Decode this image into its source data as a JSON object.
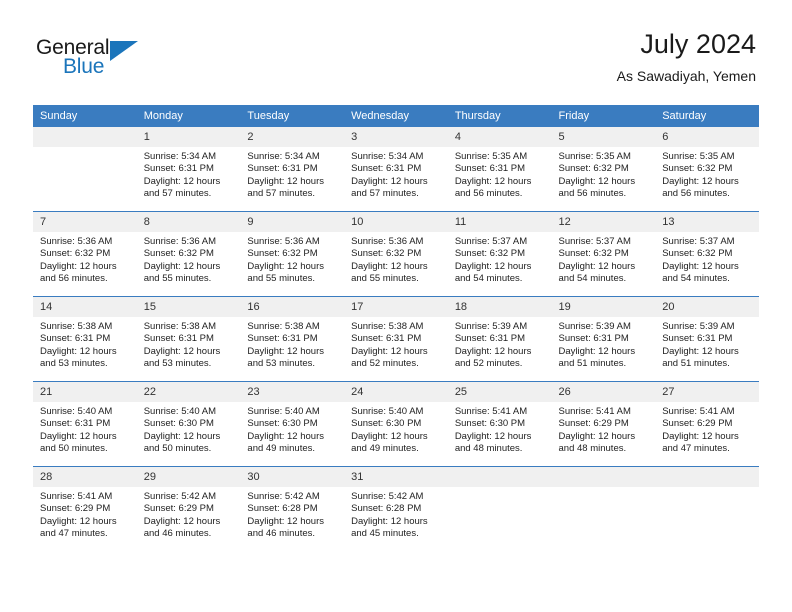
{
  "brand": {
    "name_top": "General",
    "name_bottom": "Blue",
    "accent_color": "#1b75bb"
  },
  "header": {
    "title": "July 2024",
    "location": "As Sawadiyah, Yemen"
  },
  "theme": {
    "header_row_color": "#3a7cc0",
    "daynum_strip_color": "#f0f0f0",
    "grid_line_color": "#3a7cc0",
    "text_color": "#222222"
  },
  "calendar": {
    "weekday_headers": [
      "Sunday",
      "Monday",
      "Tuesday",
      "Wednesday",
      "Thursday",
      "Friday",
      "Saturday"
    ],
    "weeks": [
      [
        {
          "day": "",
          "empty": true,
          "sunrise": "",
          "sunset": "",
          "daylight_line1": "",
          "daylight_line2": ""
        },
        {
          "day": "1",
          "empty": false,
          "sunrise": "Sunrise: 5:34 AM",
          "sunset": "Sunset: 6:31 PM",
          "daylight_line1": "Daylight: 12 hours",
          "daylight_line2": "and 57 minutes."
        },
        {
          "day": "2",
          "empty": false,
          "sunrise": "Sunrise: 5:34 AM",
          "sunset": "Sunset: 6:31 PM",
          "daylight_line1": "Daylight: 12 hours",
          "daylight_line2": "and 57 minutes."
        },
        {
          "day": "3",
          "empty": false,
          "sunrise": "Sunrise: 5:34 AM",
          "sunset": "Sunset: 6:31 PM",
          "daylight_line1": "Daylight: 12 hours",
          "daylight_line2": "and 57 minutes."
        },
        {
          "day": "4",
          "empty": false,
          "sunrise": "Sunrise: 5:35 AM",
          "sunset": "Sunset: 6:31 PM",
          "daylight_line1": "Daylight: 12 hours",
          "daylight_line2": "and 56 minutes."
        },
        {
          "day": "5",
          "empty": false,
          "sunrise": "Sunrise: 5:35 AM",
          "sunset": "Sunset: 6:32 PM",
          "daylight_line1": "Daylight: 12 hours",
          "daylight_line2": "and 56 minutes."
        },
        {
          "day": "6",
          "empty": false,
          "sunrise": "Sunrise: 5:35 AM",
          "sunset": "Sunset: 6:32 PM",
          "daylight_line1": "Daylight: 12 hours",
          "daylight_line2": "and 56 minutes."
        }
      ],
      [
        {
          "day": "7",
          "empty": false,
          "sunrise": "Sunrise: 5:36 AM",
          "sunset": "Sunset: 6:32 PM",
          "daylight_line1": "Daylight: 12 hours",
          "daylight_line2": "and 56 minutes."
        },
        {
          "day": "8",
          "empty": false,
          "sunrise": "Sunrise: 5:36 AM",
          "sunset": "Sunset: 6:32 PM",
          "daylight_line1": "Daylight: 12 hours",
          "daylight_line2": "and 55 minutes."
        },
        {
          "day": "9",
          "empty": false,
          "sunrise": "Sunrise: 5:36 AM",
          "sunset": "Sunset: 6:32 PM",
          "daylight_line1": "Daylight: 12 hours",
          "daylight_line2": "and 55 minutes."
        },
        {
          "day": "10",
          "empty": false,
          "sunrise": "Sunrise: 5:36 AM",
          "sunset": "Sunset: 6:32 PM",
          "daylight_line1": "Daylight: 12 hours",
          "daylight_line2": "and 55 minutes."
        },
        {
          "day": "11",
          "empty": false,
          "sunrise": "Sunrise: 5:37 AM",
          "sunset": "Sunset: 6:32 PM",
          "daylight_line1": "Daylight: 12 hours",
          "daylight_line2": "and 54 minutes."
        },
        {
          "day": "12",
          "empty": false,
          "sunrise": "Sunrise: 5:37 AM",
          "sunset": "Sunset: 6:32 PM",
          "daylight_line1": "Daylight: 12 hours",
          "daylight_line2": "and 54 minutes."
        },
        {
          "day": "13",
          "empty": false,
          "sunrise": "Sunrise: 5:37 AM",
          "sunset": "Sunset: 6:32 PM",
          "daylight_line1": "Daylight: 12 hours",
          "daylight_line2": "and 54 minutes."
        }
      ],
      [
        {
          "day": "14",
          "empty": false,
          "sunrise": "Sunrise: 5:38 AM",
          "sunset": "Sunset: 6:31 PM",
          "daylight_line1": "Daylight: 12 hours",
          "daylight_line2": "and 53 minutes."
        },
        {
          "day": "15",
          "empty": false,
          "sunrise": "Sunrise: 5:38 AM",
          "sunset": "Sunset: 6:31 PM",
          "daylight_line1": "Daylight: 12 hours",
          "daylight_line2": "and 53 minutes."
        },
        {
          "day": "16",
          "empty": false,
          "sunrise": "Sunrise: 5:38 AM",
          "sunset": "Sunset: 6:31 PM",
          "daylight_line1": "Daylight: 12 hours",
          "daylight_line2": "and 53 minutes."
        },
        {
          "day": "17",
          "empty": false,
          "sunrise": "Sunrise: 5:38 AM",
          "sunset": "Sunset: 6:31 PM",
          "daylight_line1": "Daylight: 12 hours",
          "daylight_line2": "and 52 minutes."
        },
        {
          "day": "18",
          "empty": false,
          "sunrise": "Sunrise: 5:39 AM",
          "sunset": "Sunset: 6:31 PM",
          "daylight_line1": "Daylight: 12 hours",
          "daylight_line2": "and 52 minutes."
        },
        {
          "day": "19",
          "empty": false,
          "sunrise": "Sunrise: 5:39 AM",
          "sunset": "Sunset: 6:31 PM",
          "daylight_line1": "Daylight: 12 hours",
          "daylight_line2": "and 51 minutes."
        },
        {
          "day": "20",
          "empty": false,
          "sunrise": "Sunrise: 5:39 AM",
          "sunset": "Sunset: 6:31 PM",
          "daylight_line1": "Daylight: 12 hours",
          "daylight_line2": "and 51 minutes."
        }
      ],
      [
        {
          "day": "21",
          "empty": false,
          "sunrise": "Sunrise: 5:40 AM",
          "sunset": "Sunset: 6:31 PM",
          "daylight_line1": "Daylight: 12 hours",
          "daylight_line2": "and 50 minutes."
        },
        {
          "day": "22",
          "empty": false,
          "sunrise": "Sunrise: 5:40 AM",
          "sunset": "Sunset: 6:30 PM",
          "daylight_line1": "Daylight: 12 hours",
          "daylight_line2": "and 50 minutes."
        },
        {
          "day": "23",
          "empty": false,
          "sunrise": "Sunrise: 5:40 AM",
          "sunset": "Sunset: 6:30 PM",
          "daylight_line1": "Daylight: 12 hours",
          "daylight_line2": "and 49 minutes."
        },
        {
          "day": "24",
          "empty": false,
          "sunrise": "Sunrise: 5:40 AM",
          "sunset": "Sunset: 6:30 PM",
          "daylight_line1": "Daylight: 12 hours",
          "daylight_line2": "and 49 minutes."
        },
        {
          "day": "25",
          "empty": false,
          "sunrise": "Sunrise: 5:41 AM",
          "sunset": "Sunset: 6:30 PM",
          "daylight_line1": "Daylight: 12 hours",
          "daylight_line2": "and 48 minutes."
        },
        {
          "day": "26",
          "empty": false,
          "sunrise": "Sunrise: 5:41 AM",
          "sunset": "Sunset: 6:29 PM",
          "daylight_line1": "Daylight: 12 hours",
          "daylight_line2": "and 48 minutes."
        },
        {
          "day": "27",
          "empty": false,
          "sunrise": "Sunrise: 5:41 AM",
          "sunset": "Sunset: 6:29 PM",
          "daylight_line1": "Daylight: 12 hours",
          "daylight_line2": "and 47 minutes."
        }
      ],
      [
        {
          "day": "28",
          "empty": false,
          "sunrise": "Sunrise: 5:41 AM",
          "sunset": "Sunset: 6:29 PM",
          "daylight_line1": "Daylight: 12 hours",
          "daylight_line2": "and 47 minutes."
        },
        {
          "day": "29",
          "empty": false,
          "sunrise": "Sunrise: 5:42 AM",
          "sunset": "Sunset: 6:29 PM",
          "daylight_line1": "Daylight: 12 hours",
          "daylight_line2": "and 46 minutes."
        },
        {
          "day": "30",
          "empty": false,
          "sunrise": "Sunrise: 5:42 AM",
          "sunset": "Sunset: 6:28 PM",
          "daylight_line1": "Daylight: 12 hours",
          "daylight_line2": "and 46 minutes."
        },
        {
          "day": "31",
          "empty": false,
          "sunrise": "Sunrise: 5:42 AM",
          "sunset": "Sunset: 6:28 PM",
          "daylight_line1": "Daylight: 12 hours",
          "daylight_line2": "and 45 minutes."
        },
        {
          "day": "",
          "empty": true,
          "sunrise": "",
          "sunset": "",
          "daylight_line1": "",
          "daylight_line2": ""
        },
        {
          "day": "",
          "empty": true,
          "sunrise": "",
          "sunset": "",
          "daylight_line1": "",
          "daylight_line2": ""
        },
        {
          "day": "",
          "empty": true,
          "sunrise": "",
          "sunset": "",
          "daylight_line1": "",
          "daylight_line2": ""
        }
      ]
    ]
  }
}
